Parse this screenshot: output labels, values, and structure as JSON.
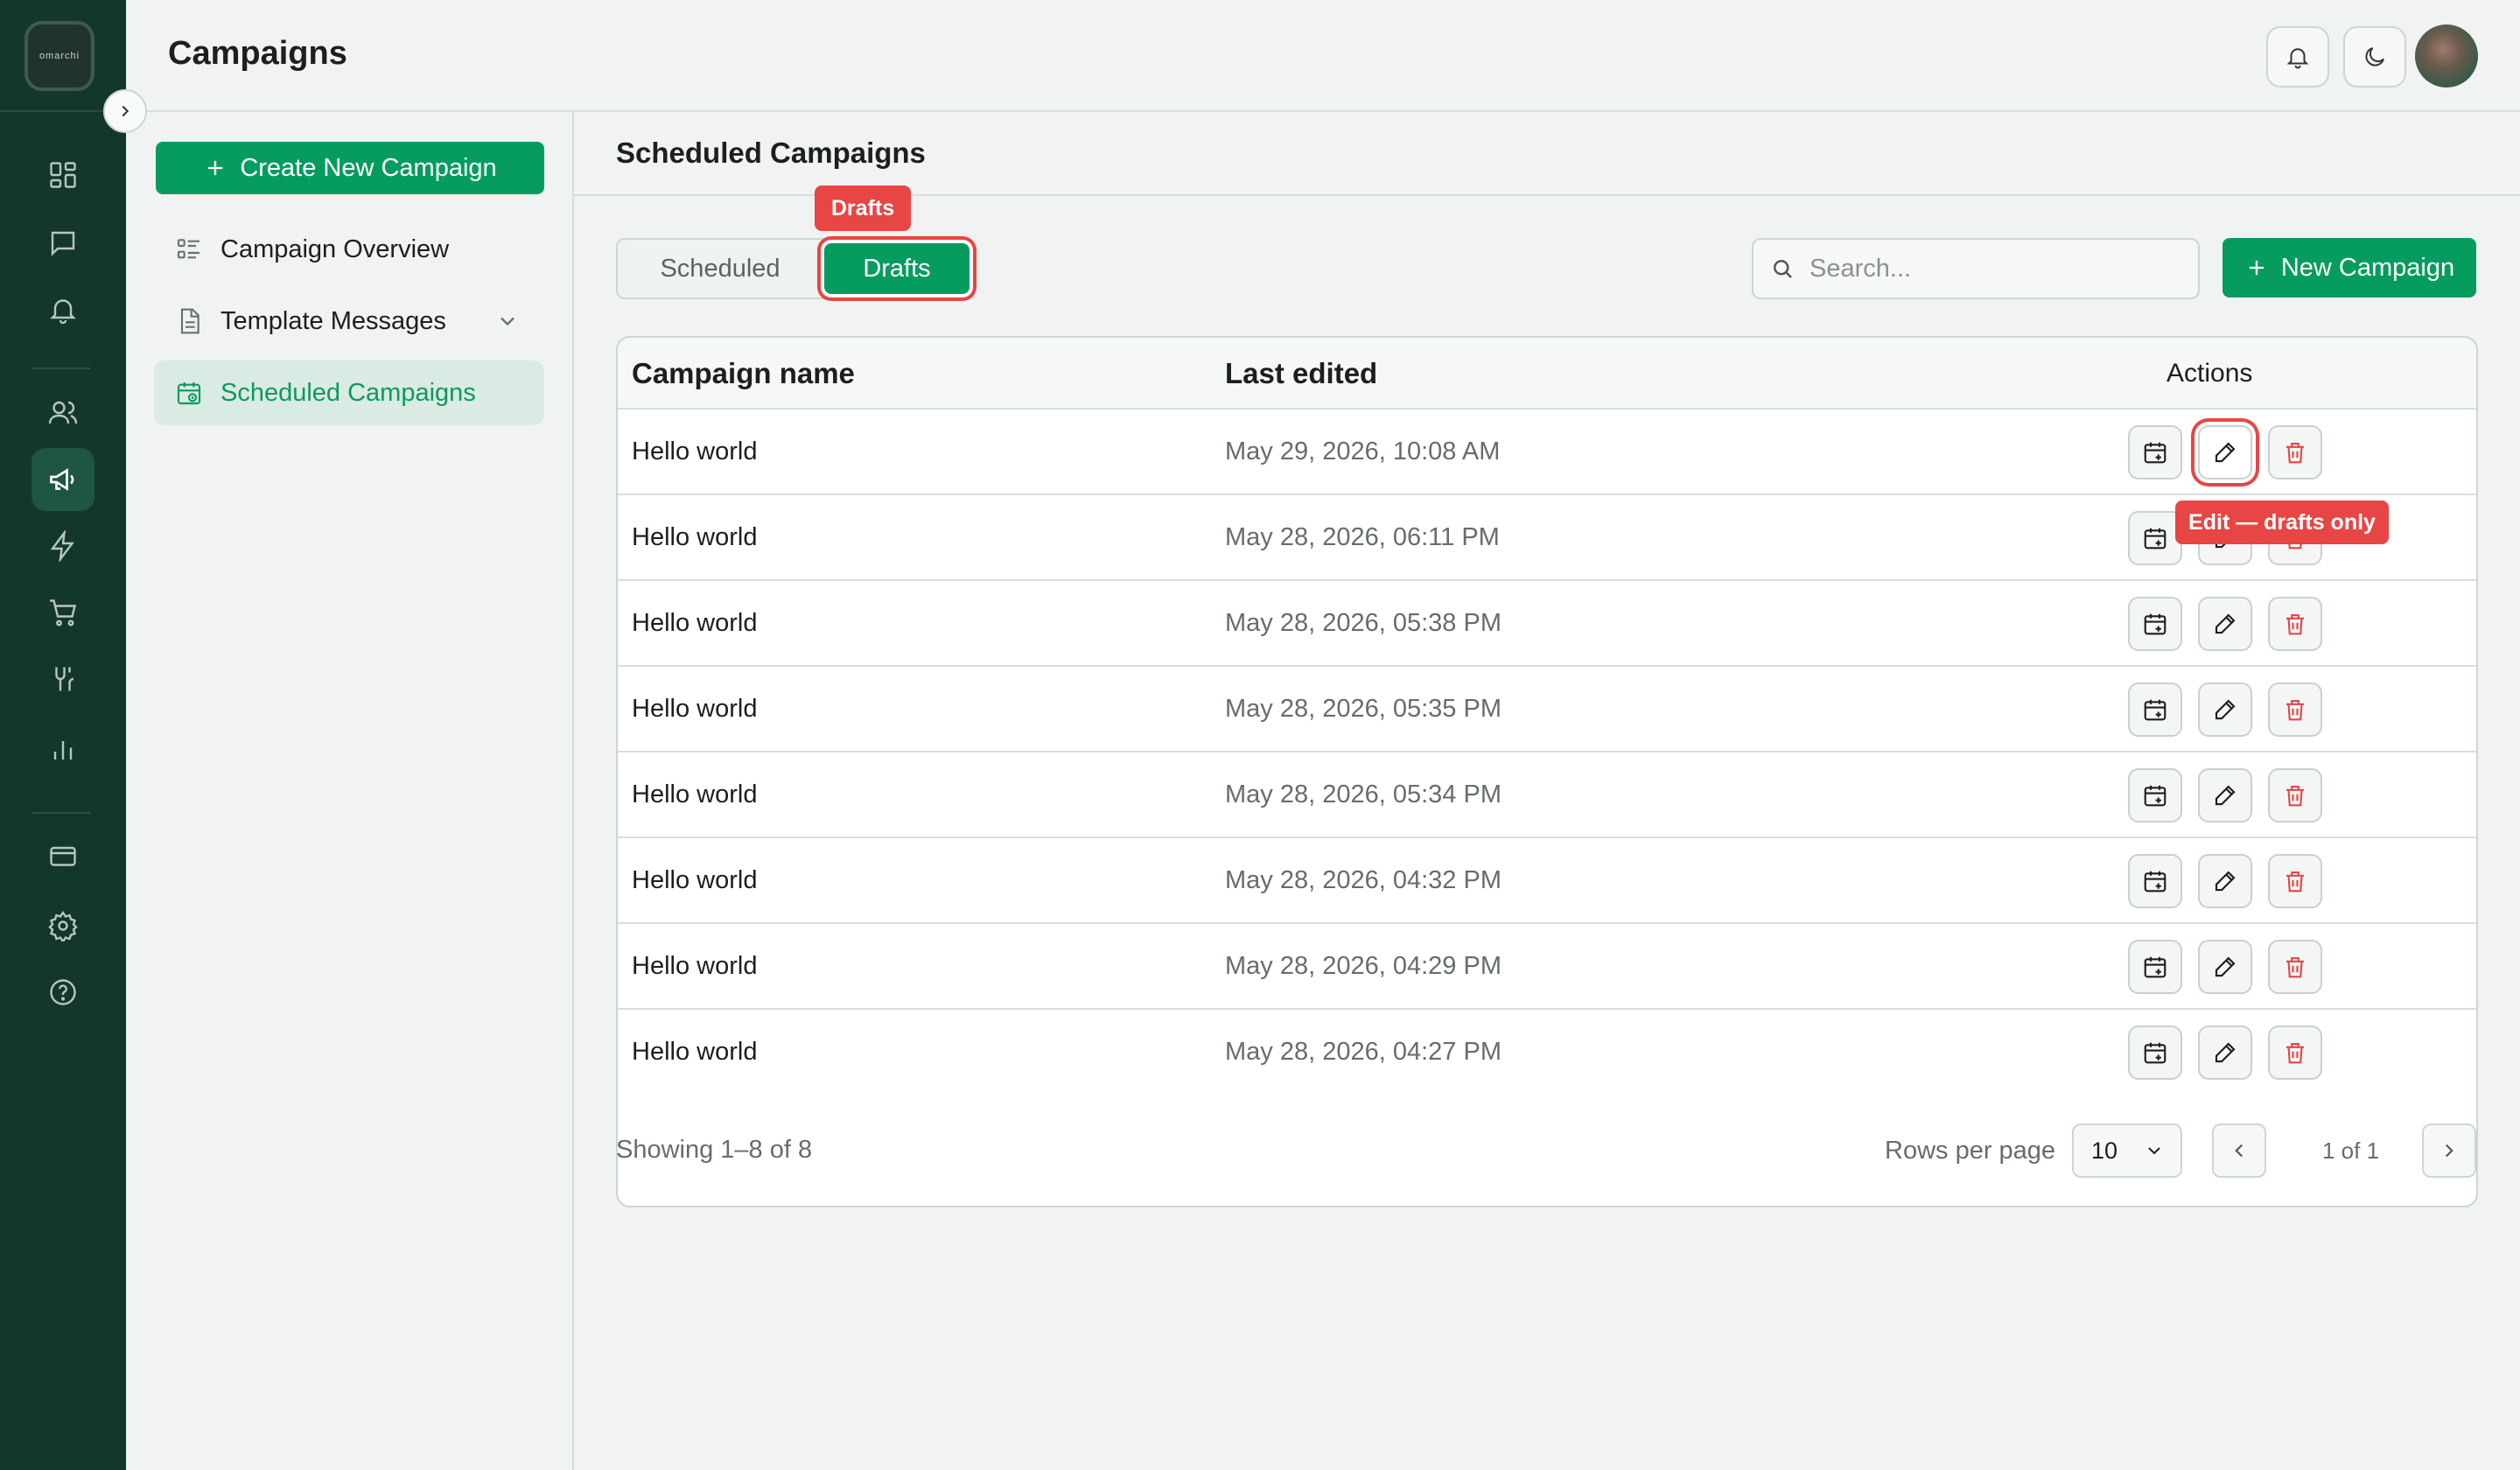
{
  "brand": {
    "logo_text": "omarchi"
  },
  "header": {
    "title": "Campaigns"
  },
  "sidebar": {
    "create_label": "Create New Campaign",
    "items": [
      {
        "label": "Campaign Overview"
      },
      {
        "label": "Template Messages"
      },
      {
        "label": "Scheduled Campaigns"
      }
    ]
  },
  "main": {
    "title": "Scheduled Campaigns",
    "tabs": [
      {
        "label": "Scheduled"
      },
      {
        "label": "Drafts"
      }
    ],
    "drafts_badge": "Drafts",
    "search_placeholder": "Search...",
    "new_campaign_label": "New Campaign",
    "table": {
      "headers": {
        "name": "Campaign name",
        "edited": "Last edited",
        "actions": "Actions"
      },
      "rows": [
        {
          "name": "Hello world",
          "edited": "May 29, 2026, 10:08 AM"
        },
        {
          "name": "Hello world",
          "edited": "May 28, 2026, 06:11 PM"
        },
        {
          "name": "Hello world",
          "edited": "May 28, 2026, 05:38 PM"
        },
        {
          "name": "Hello world",
          "edited": "May 28, 2026, 05:35 PM"
        },
        {
          "name": "Hello world",
          "edited": "May 28, 2026, 05:34 PM"
        },
        {
          "name": "Hello world",
          "edited": "May 28, 2026, 04:32 PM"
        },
        {
          "name": "Hello world",
          "edited": "May 28, 2026, 04:29 PM"
        },
        {
          "name": "Hello world",
          "edited": "May 28, 2026, 04:27 PM"
        }
      ]
    },
    "edit_tooltip": "Edit — drafts only",
    "footer": {
      "showing": "Showing 1–8 of 8",
      "rows_per_page_label": "Rows per page",
      "rows_per_page_value": "10",
      "page_indicator": "1 of 1"
    }
  },
  "colors": {
    "accent": "#079c5f",
    "rail": "#14372d",
    "highlight": "#e84545"
  }
}
